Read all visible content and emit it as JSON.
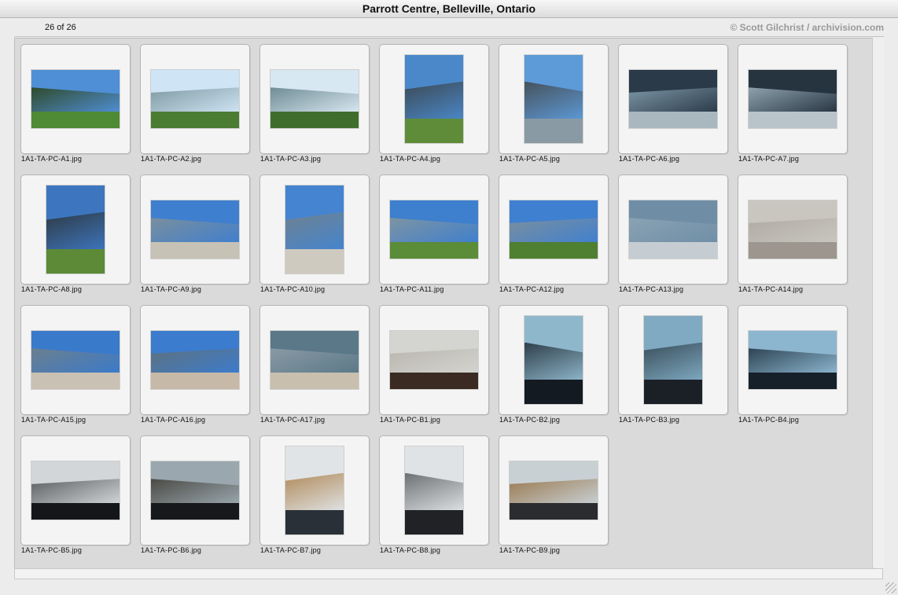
{
  "window": {
    "title": "Parrott Centre, Belleville, Ontario"
  },
  "header": {
    "count": "26 of 26",
    "credit": "© Scott Gilchrist / archivision.com"
  },
  "thumbnails": [
    {
      "file": "1A1-TA-PC-A1.jpg",
      "orientation": "landscape",
      "colors": {
        "sky": "#4f8fd6",
        "mass": "#2f4a2b",
        "ground": "#4f8a34"
      }
    },
    {
      "file": "1A1-TA-PC-A2.jpg",
      "orientation": "landscape",
      "colors": {
        "sky": "#cfe4f4",
        "mass": "#7f9aa2",
        "ground": "#4a7c32"
      }
    },
    {
      "file": "1A1-TA-PC-A3.jpg",
      "orientation": "landscape",
      "colors": {
        "sky": "#d8e8f2",
        "mass": "#6f8c94",
        "ground": "#3f6e2c"
      }
    },
    {
      "file": "1A1-TA-PC-A4.jpg",
      "orientation": "portrait",
      "colors": {
        "sky": "#4a88c9",
        "mass": "#3c4a55",
        "ground": "#5e8c38"
      }
    },
    {
      "file": "1A1-TA-PC-A5.jpg",
      "orientation": "portrait",
      "colors": {
        "sky": "#5d9ad8",
        "mass": "#46525c",
        "ground": "#8a9aa4"
      }
    },
    {
      "file": "1A1-TA-PC-A6.jpg",
      "orientation": "landscape",
      "colors": {
        "sky": "#2a3a48",
        "mass": "#7c96a6",
        "ground": "#a9b7bf"
      }
    },
    {
      "file": "1A1-TA-PC-A7.jpg",
      "orientation": "landscape",
      "colors": {
        "sky": "#263440",
        "mass": "#8ea2ae",
        "ground": "#b9c4ca"
      }
    },
    {
      "file": "1A1-TA-PC-A8.jpg",
      "orientation": "portrait",
      "colors": {
        "sky": "#3d76bf",
        "mass": "#2e3a44",
        "ground": "#5c8a36"
      }
    },
    {
      "file": "1A1-TA-PC-A9.jpg",
      "orientation": "landscape",
      "colors": {
        "sky": "#3f7fcf",
        "mass": "#7a8f9c",
        "ground": "#c7c2b6"
      }
    },
    {
      "file": "1A1-TA-PC-A10.jpg",
      "orientation": "portrait",
      "colors": {
        "sky": "#4484d0",
        "mass": "#6f8290",
        "ground": "#cfcac0"
      }
    },
    {
      "file": "1A1-TA-PC-A11.jpg",
      "orientation": "landscape",
      "colors": {
        "sky": "#3e7fce",
        "mass": "#7e94a2",
        "ground": "#5b8c37"
      }
    },
    {
      "file": "1A1-TA-PC-A12.jpg",
      "orientation": "landscape",
      "colors": {
        "sky": "#3f80d0",
        "mass": "#7b8f9d",
        "ground": "#4f7f30"
      }
    },
    {
      "file": "1A1-TA-PC-A13.jpg",
      "orientation": "landscape",
      "colors": {
        "sky": "#6f8ea6",
        "mass": "#8aa2b4",
        "ground": "#c6cdd2"
      }
    },
    {
      "file": "1A1-TA-PC-A14.jpg",
      "orientation": "landscape",
      "colors": {
        "sky": "#c9c6c0",
        "mass": "#b0aca4",
        "ground": "#9c968e"
      }
    },
    {
      "file": "1A1-TA-PC-A15.jpg",
      "orientation": "landscape",
      "colors": {
        "sky": "#3a7acb",
        "mass": "#6c7f8d",
        "ground": "#c9c1b3"
      }
    },
    {
      "file": "1A1-TA-PC-A16.jpg",
      "orientation": "landscape",
      "colors": {
        "sky": "#3b7cce",
        "mass": "#5e717e",
        "ground": "#c7b9a7"
      }
    },
    {
      "file": "1A1-TA-PC-A17.jpg",
      "orientation": "landscape",
      "colors": {
        "sky": "#5a7888",
        "mass": "#8a9aa4",
        "ground": "#c9bfae"
      }
    },
    {
      "file": "1A1-TA-PC-B1.jpg",
      "orientation": "landscape",
      "colors": {
        "sky": "#d4d4d0",
        "mass": "#b9b6ae",
        "ground": "#3a2a22"
      }
    },
    {
      "file": "1A1-TA-PC-B2.jpg",
      "orientation": "portrait",
      "colors": {
        "sky": "#8fb7cc",
        "mass": "#2f3f4a",
        "ground": "#141a22"
      }
    },
    {
      "file": "1A1-TA-PC-B3.jpg",
      "orientation": "portrait",
      "colors": {
        "sky": "#7faac2",
        "mass": "#3a4e5a",
        "ground": "#1b2027"
      }
    },
    {
      "file": "1A1-TA-PC-B4.jpg",
      "orientation": "landscape",
      "colors": {
        "sky": "#8cb6cf",
        "mass": "#2e4454",
        "ground": "#15202a"
      }
    },
    {
      "file": "1A1-TA-PC-B5.jpg",
      "orientation": "landscape",
      "colors": {
        "sky": "#d2d6d8",
        "mass": "#5b5f62",
        "ground": "#15161a"
      }
    },
    {
      "file": "1A1-TA-PC-B6.jpg",
      "orientation": "landscape",
      "colors": {
        "sky": "#9aa7ae",
        "mass": "#4a4a44",
        "ground": "#17181b"
      }
    },
    {
      "file": "1A1-TA-PC-B7.jpg",
      "orientation": "portrait",
      "colors": {
        "sky": "#e0e4e6",
        "mass": "#b08a5a",
        "ground": "#2a3038"
      }
    },
    {
      "file": "1A1-TA-PC-B8.jpg",
      "orientation": "portrait",
      "colors": {
        "sky": "#dfe3e5",
        "mass": "#6d7174",
        "ground": "#202226"
      }
    },
    {
      "file": "1A1-TA-PC-B9.jpg",
      "orientation": "landscape",
      "colors": {
        "sky": "#c8d0d4",
        "mass": "#9a7a52",
        "ground": "#2b2c30"
      }
    }
  ]
}
